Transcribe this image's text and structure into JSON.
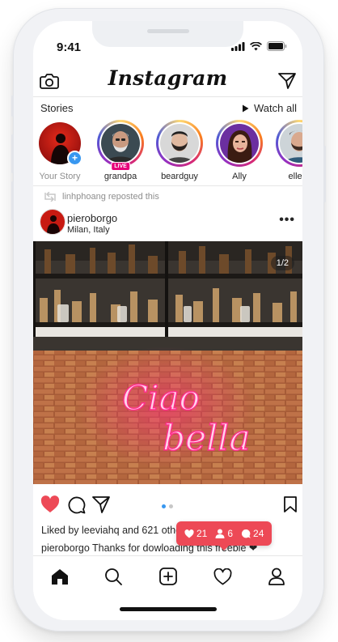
{
  "status_bar": {
    "time": "9:41"
  },
  "header": {
    "title": "Instagram"
  },
  "stories": {
    "title": "Stories",
    "watch_all": "Watch all",
    "items": [
      {
        "label": "Your Story"
      },
      {
        "label": "grandpa",
        "badge": "LIVE"
      },
      {
        "label": "beardguy"
      },
      {
        "label": "Ally"
      },
      {
        "label": "ellera"
      }
    ]
  },
  "post": {
    "repost_text": "linhphoang reposted this",
    "username": "pieroborgo",
    "location": "Milan, Italy",
    "more": "•••",
    "page_indicator": "1/2",
    "neon_text": [
      "Ciao",
      "bella"
    ],
    "liked_text": "Liked by leeviahq and 621 othe",
    "caption_user": "pieroborgo",
    "caption_text": " Thanks for dowloading this freebie ❤"
  },
  "notification": {
    "likes": "21",
    "follows": "6",
    "comments": "24"
  },
  "colors": {
    "accent_red": "#ed4956",
    "link_blue": "#3897f0"
  },
  "tabbar": {
    "items": [
      "home-icon",
      "search-icon",
      "add-post-icon",
      "activity-icon",
      "profile-icon"
    ]
  }
}
